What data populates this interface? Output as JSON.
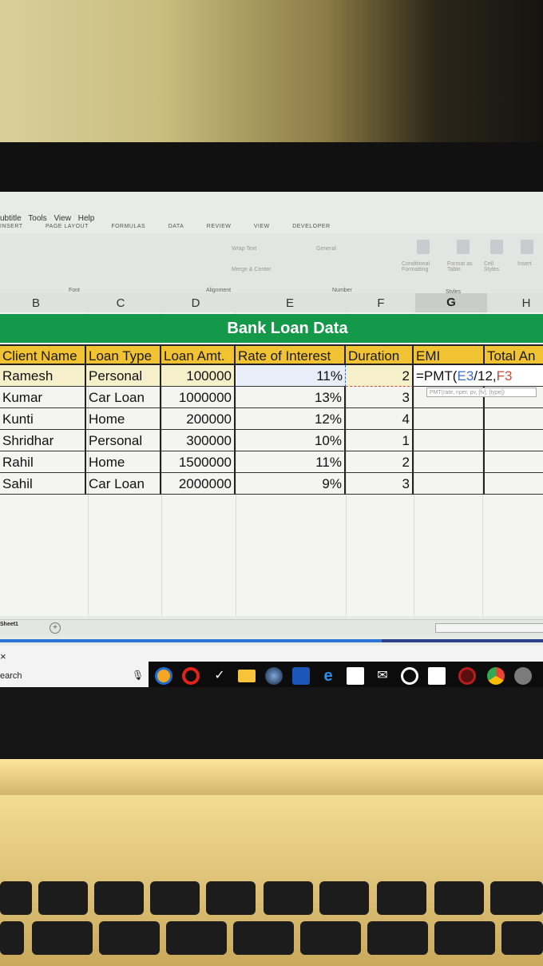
{
  "menu": [
    "ubtitle",
    "Tools",
    "View",
    "Help"
  ],
  "ribbon_tabs": [
    "INSERT",
    "PAGE LAYOUT",
    "FORMULAS",
    "DATA",
    "REVIEW",
    "VIEW",
    "DEVELOPER"
  ],
  "ribbon_groups": {
    "font": "Font",
    "alignment": "Alignment",
    "number": "Number",
    "styles": "Styles",
    "wrap_text": "Wrap Text",
    "merge_center": "Merge & Center",
    "number_format": "General",
    "conditional": "Conditional Formatting",
    "format_as_table": "Format as Table",
    "cell_styles": "Cell Styles",
    "insert": "Insert"
  },
  "columns": [
    "B",
    "C",
    "D",
    "E",
    "F",
    "G",
    "H"
  ],
  "selected_column": "G",
  "sheet": {
    "title": "Bank Loan Data",
    "headers": [
      "Client Name",
      "Loan Type",
      "Loan Amt.",
      "Rate of Interest",
      "Duration",
      "EMI",
      "Total An"
    ],
    "rows": [
      {
        "name": "Ramesh",
        "type": "Personal",
        "amount": "100000",
        "rate": "11%",
        "duration": "2"
      },
      {
        "name": "Kumar",
        "type": "Car Loan",
        "amount": "1000000",
        "rate": "13%",
        "duration": "3"
      },
      {
        "name": "Kunti",
        "type": "Home",
        "amount": "200000",
        "rate": "12%",
        "duration": "4"
      },
      {
        "name": "Shridhar",
        "type": "Personal",
        "amount": "300000",
        "rate": "10%",
        "duration": "1"
      },
      {
        "name": "Rahil",
        "type": "Home",
        "amount": "1500000",
        "rate": "11%",
        "duration": "2"
      },
      {
        "name": "Sahil",
        "type": "Car Loan",
        "amount": "2000000",
        "rate": "9%",
        "duration": "3"
      }
    ],
    "formula": {
      "prefix": "=PMT(",
      "ref1": "E3",
      "mid": "/12,",
      "ref2": "F3"
    },
    "formula_tooltip": "PMT(rate, nper, pv, [fv], [type])"
  },
  "sheet_tab": "Sheet1",
  "taskbar": {
    "search_label": "earch",
    "close": "×"
  },
  "colors": {
    "title_bg": "#14994a",
    "header_bg": "#f1c231",
    "accent_blue": "#2b73d6"
  }
}
